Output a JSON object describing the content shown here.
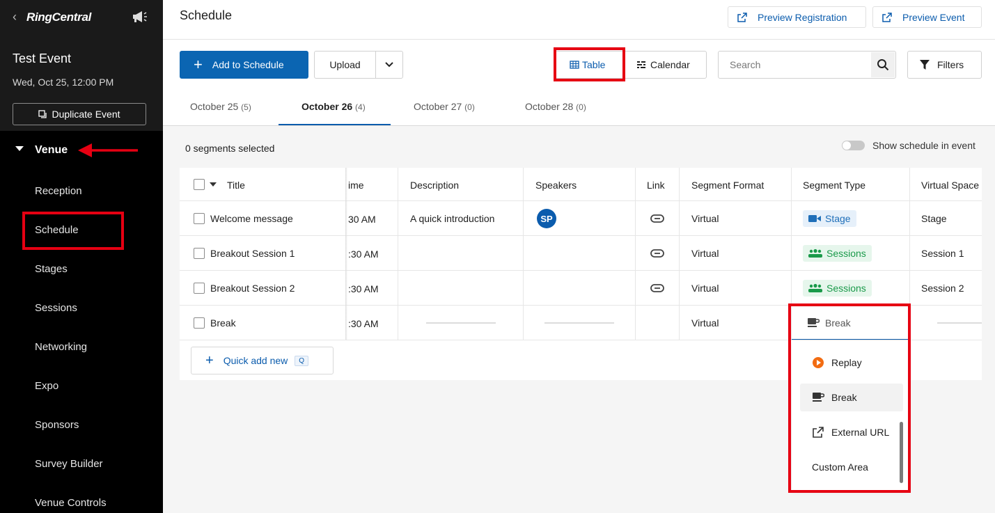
{
  "sidebar": {
    "logo": "RingCentral",
    "event_title": "Test Event",
    "event_date": "Wed, Oct 25, 12:00 PM",
    "duplicate_label": "Duplicate Event",
    "venue_label": "Venue",
    "items": [
      {
        "label": "Reception"
      },
      {
        "label": "Schedule"
      },
      {
        "label": "Stages"
      },
      {
        "label": "Sessions"
      },
      {
        "label": "Networking"
      },
      {
        "label": "Expo"
      },
      {
        "label": "Sponsors"
      },
      {
        "label": "Survey Builder"
      },
      {
        "label": "Venue Controls"
      }
    ]
  },
  "header": {
    "title": "Schedule",
    "preview_registration": "Preview Registration",
    "preview_event": "Preview Event"
  },
  "toolbar": {
    "add_label": "Add to Schedule",
    "upload_label": "Upload",
    "table_label": "Table",
    "calendar_label": "Calendar",
    "search_placeholder": "Search",
    "filters_label": "Filters"
  },
  "tabs": [
    {
      "label": "October 25",
      "count": "(5)"
    },
    {
      "label": "October 26",
      "count": "(4)",
      "active": true
    },
    {
      "label": "October 27",
      "count": "(0)"
    },
    {
      "label": "October 28",
      "count": "(0)"
    }
  ],
  "selection_text": "0 segments selected",
  "show_schedule_label": "Show schedule in event",
  "table": {
    "headers": {
      "title": "Title",
      "time": "ime",
      "description": "Description",
      "speakers": "Speakers",
      "link": "Link",
      "format": "Segment Format",
      "type": "Segment Type",
      "space": "Virtual Space"
    },
    "rows": [
      {
        "title": "Welcome message",
        "time": "30 AM",
        "description": "A quick introduction",
        "speaker": "SP",
        "format": "Virtual",
        "type": "Stage",
        "space": "Stage"
      },
      {
        "title": "Breakout Session 1",
        "time": ":30 AM",
        "description": "",
        "speaker": "",
        "format": "Virtual",
        "type": "Sessions",
        "space": "Session 1"
      },
      {
        "title": "Breakout Session 2",
        "time": ":30 AM",
        "description": "",
        "speaker": "",
        "format": "Virtual",
        "type": "Sessions",
        "space": "Session 2"
      },
      {
        "title": "Break",
        "time": ":30 AM",
        "description": "",
        "speaker": "",
        "format": "Virtual",
        "type": "Break",
        "space": ""
      }
    ],
    "quick_add_label": "Quick add new",
    "quick_add_key": "Q"
  },
  "segment_dropdown": {
    "selected": "Break",
    "options": [
      {
        "label": "Replay",
        "icon": "replay-icon"
      },
      {
        "label": "Break",
        "icon": "coffee-icon"
      },
      {
        "label": "External URL",
        "icon": "external-link-icon"
      },
      {
        "label": "Custom Area",
        "icon": ""
      }
    ]
  },
  "colors": {
    "primary": "#0b65b2",
    "annotation_red": "#e60012",
    "stage_pill": "#1f6fb9",
    "sessions_pill": "#1a9a4a",
    "replay_orange": "#f26c12"
  }
}
